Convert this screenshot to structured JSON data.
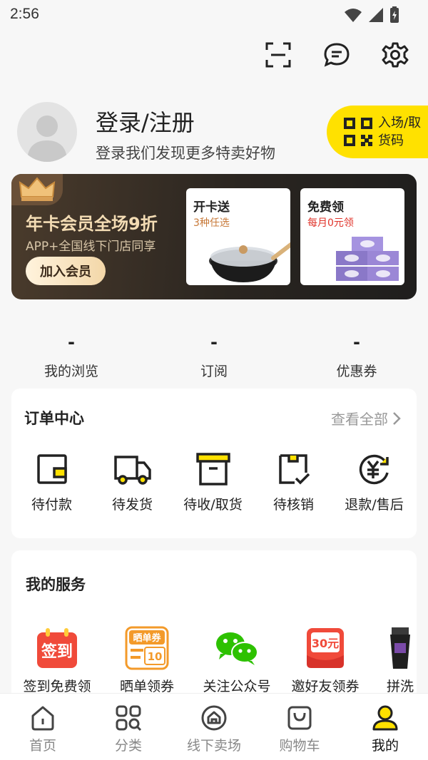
{
  "status_bar": {
    "time": "2:56"
  },
  "profile": {
    "title": "登录/注册",
    "subtitle": "登录我们发现更多特卖好物"
  },
  "entry_button": {
    "label": "入场/取货码"
  },
  "vip": {
    "title": "年卡会员全场9折",
    "subtitle": "APP+全国线下门店同享",
    "join_label": "加入会员",
    "promos": [
      {
        "title": "开卡送",
        "subtitle": "3种任选",
        "subtitle_color": "#c87a3a"
      },
      {
        "title": "免费领",
        "subtitle": "每月0元领",
        "subtitle_color": "#e0342b"
      }
    ]
  },
  "stats": [
    {
      "value": "-",
      "label": "我的浏览"
    },
    {
      "value": "-",
      "label": "订阅"
    },
    {
      "value": "-",
      "label": "优惠券"
    }
  ],
  "orders": {
    "title": "订单中心",
    "view_all": "查看全部",
    "items": [
      {
        "label": "待付款",
        "icon": "wallet-icon"
      },
      {
        "label": "待发货",
        "icon": "truck-icon"
      },
      {
        "label": "待收/取货",
        "icon": "box-icon"
      },
      {
        "label": "待核销",
        "icon": "verify-bag-icon"
      },
      {
        "label": "退款/售后",
        "icon": "refund-yen-icon"
      }
    ]
  },
  "services": {
    "title": "我的服务",
    "items": [
      {
        "label": "签到免费领",
        "icon": "checkin-calendar-icon",
        "badge": "签到"
      },
      {
        "label": "晒单领券",
        "icon": "share-coupon-icon",
        "badge": "晒单券",
        "badge_num": "10"
      },
      {
        "label": "关注公众号",
        "icon": "wechat-icon"
      },
      {
        "label": "邀好友领券",
        "icon": "invite-coupon-icon",
        "badge": "30元"
      },
      {
        "label": "拼洗",
        "icon": "product-tube-icon"
      }
    ]
  },
  "tabbar": {
    "items": [
      {
        "label": "首页",
        "icon": "home-icon"
      },
      {
        "label": "分类",
        "icon": "category-icon"
      },
      {
        "label": "线下卖场",
        "icon": "store-icon"
      },
      {
        "label": "购物车",
        "icon": "cart-icon"
      },
      {
        "label": "我的",
        "icon": "user-icon",
        "active": true
      }
    ]
  },
  "colors": {
    "accent_yellow": "#ffe100",
    "vip_gold": "#f3dcb4"
  }
}
